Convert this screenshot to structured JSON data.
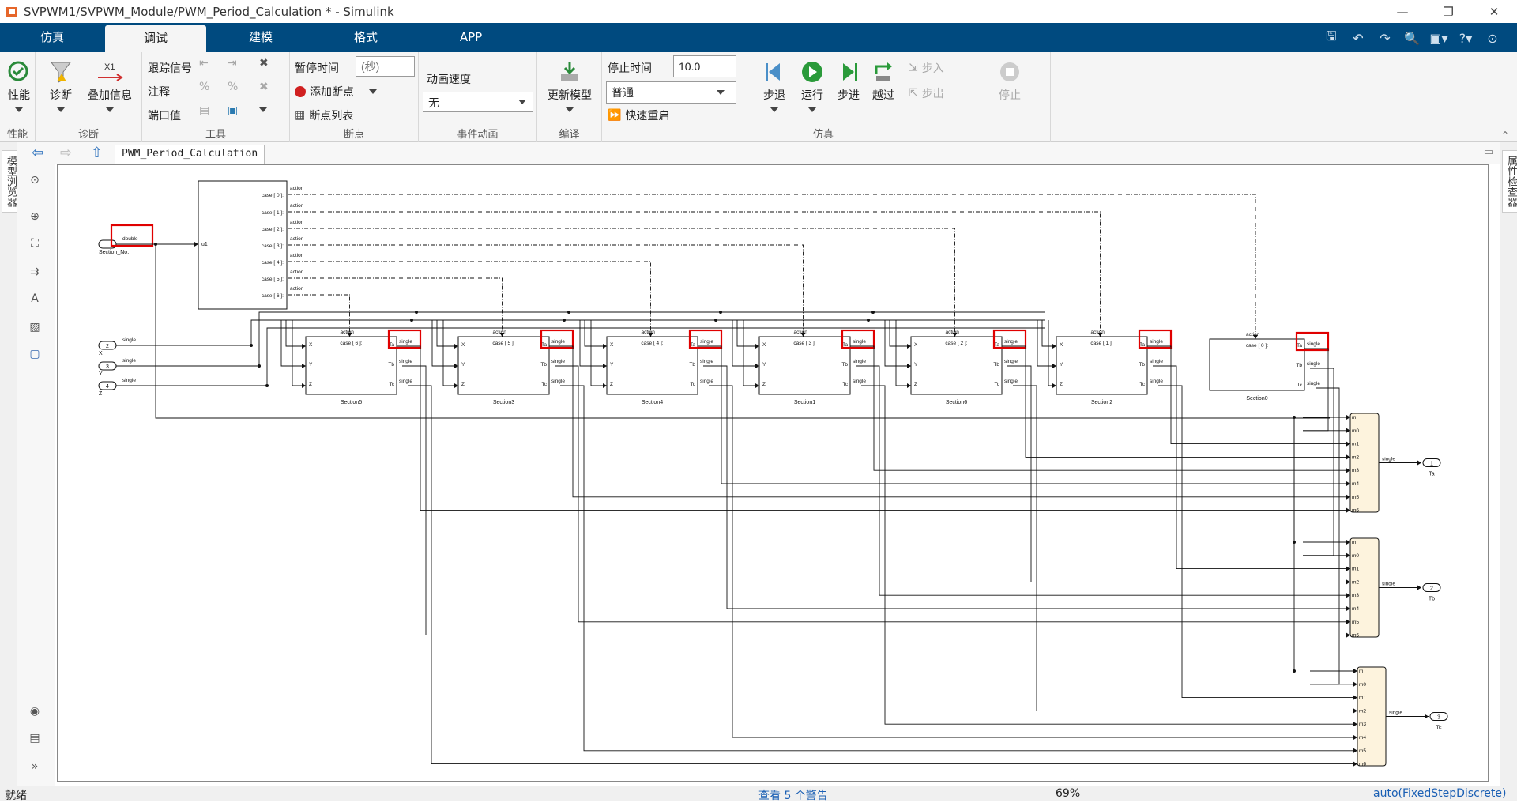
{
  "window": {
    "title": "SVPWM1/SVPWM_Module/PWM_Period_Calculation * - Simulink",
    "controls": [
      "—",
      "❐",
      "✕"
    ]
  },
  "tabs": [
    {
      "label": "仿真"
    },
    {
      "label": "调试",
      "active": true
    },
    {
      "label": "建模"
    },
    {
      "label": "格式"
    },
    {
      "label": "APP"
    }
  ],
  "ribbon": {
    "perf": {
      "btn": "性能",
      "group": "性能"
    },
    "diag": {
      "btn1": "诊断",
      "btn2": "叠加信息",
      "group": "诊断"
    },
    "tools": {
      "trace": "跟踪信号",
      "annot": "注释",
      "port": "端口值",
      "group": "工具"
    },
    "breakpoints": {
      "pause_label": "暂停时间",
      "pause_placeholder": "(秒)",
      "add": "添加断点",
      "list": "断点列表",
      "group": "断点"
    },
    "anim": {
      "label": "动画速度",
      "value": "无",
      "group": "事件动画"
    },
    "compile": {
      "btn": "更新模型",
      "group": "编译"
    },
    "sim": {
      "stop_label": "停止时间",
      "stop_value": "10.0",
      "mode": "普通",
      "fast_restart": "快速重启",
      "back": "步退",
      "run": "运行",
      "step": "步进",
      "over": "越过",
      "in": "步入",
      "out": "步出",
      "stop": "停止",
      "group": "仿真"
    }
  },
  "side": {
    "left": "模型浏览器",
    "right": "属性检查器"
  },
  "breadcrumb": "PWM_Period_Calculation",
  "model": {
    "inports": [
      {
        "num": "1",
        "name": "Section_No.",
        "type": "double"
      },
      {
        "num": "2",
        "name": "X",
        "type": "single"
      },
      {
        "num": "3",
        "name": "Y",
        "type": "single"
      },
      {
        "num": "4",
        "name": "Z",
        "type": "single"
      }
    ],
    "switch_case": {
      "input": "u1",
      "cases": [
        "case [ 0 ]:",
        "case [ 1 ]:",
        "case [ 2 ]:",
        "case [ 3 ]:",
        "case [ 4 ]:",
        "case [ 5 ]:",
        "case [ 6 ]:"
      ],
      "action": "action"
    },
    "sections": [
      {
        "name": "Section5",
        "case": "case [ 6 ]:"
      },
      {
        "name": "Section3",
        "case": "case [ 5 ]:"
      },
      {
        "name": "Section4",
        "case": "case [ 4 ]:"
      },
      {
        "name": "Section1",
        "case": "case [ 3 ]:"
      },
      {
        "name": "Section6",
        "case": "case [ 2 ]:"
      },
      {
        "name": "Section2",
        "case": "case [ 1 ]:"
      },
      {
        "name": "Section0",
        "case": "case [ 0 ]:"
      }
    ],
    "section_ports": {
      "in": [
        "X",
        "Y",
        "Z"
      ],
      "out": [
        "Ta",
        "Tb",
        "Tc"
      ]
    },
    "mux_inputs": [
      "m",
      "m0",
      "m1",
      "m2",
      "m3",
      "m4",
      "m5",
      "m6"
    ],
    "outports": [
      {
        "num": "1",
        "name": "Ta"
      },
      {
        "num": "2",
        "name": "Tb"
      },
      {
        "num": "3",
        "name": "Tc"
      }
    ],
    "signal_type": "single"
  },
  "status": {
    "ready": "就绪",
    "warnings": "查看 5 个警告",
    "zoom": "69%",
    "solver": "auto(FixedStepDiscrete)"
  },
  "colors": {
    "tabbar": "#004a7f",
    "highlight": "#e00000",
    "merge_fill": "#fdf3dd"
  }
}
